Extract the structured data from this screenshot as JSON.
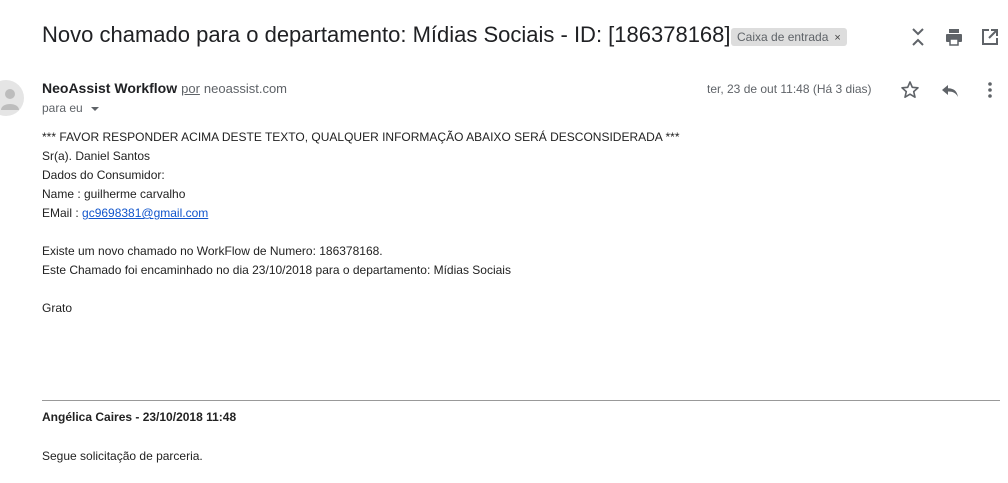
{
  "email": {
    "subject": "Novo chamado para o departamento: Mídias Sociais - ID: [186378168]",
    "label": "Caixa de entrada",
    "label_remove": "×",
    "sender_name": "NeoAssist Workflow",
    "via": "por",
    "sender_domain": "neoassist.com",
    "to": "para eu",
    "date": "ter, 23 de out 11:48 (Há 3 dias)"
  },
  "body": {
    "lines": [
      "*** FAVOR RESPONDER ACIMA DESTE TEXTO, QUALQUER INFORMAÇÃO ABAIXO SERÁ DESCONSIDERADA ***",
      "Sr(a). Daniel Santos",
      "Dados do Consumidor:",
      "Name : guilherme carvalho"
    ],
    "email_label": "EMail : ",
    "email_link": "gc9698381@gmail.com",
    "para2": [
      "Existe um novo chamado no WorkFlow de Numero: 186378168.",
      "Este Chamado foi encaminhado no dia 23/10/2018 para o departamento: Mídias Sociais"
    ],
    "closing": "Grato"
  },
  "reply": {
    "author": "Angélica Caires - 23/10/2018 11:48",
    "text": "Segue solicitação de parceria."
  },
  "colors": {
    "icon": "#5f6368",
    "link": "#1155cc",
    "chip_bg": "#dddddd"
  },
  "icons": {
    "collapse": "collapse-all-icon",
    "print": "print-icon",
    "new_window": "open-in-new-window-icon",
    "star": "star-icon",
    "reply": "reply-icon",
    "more": "more-vert-icon",
    "avatar": "avatar-icon",
    "dropdown": "dropdown-arrow-icon"
  }
}
